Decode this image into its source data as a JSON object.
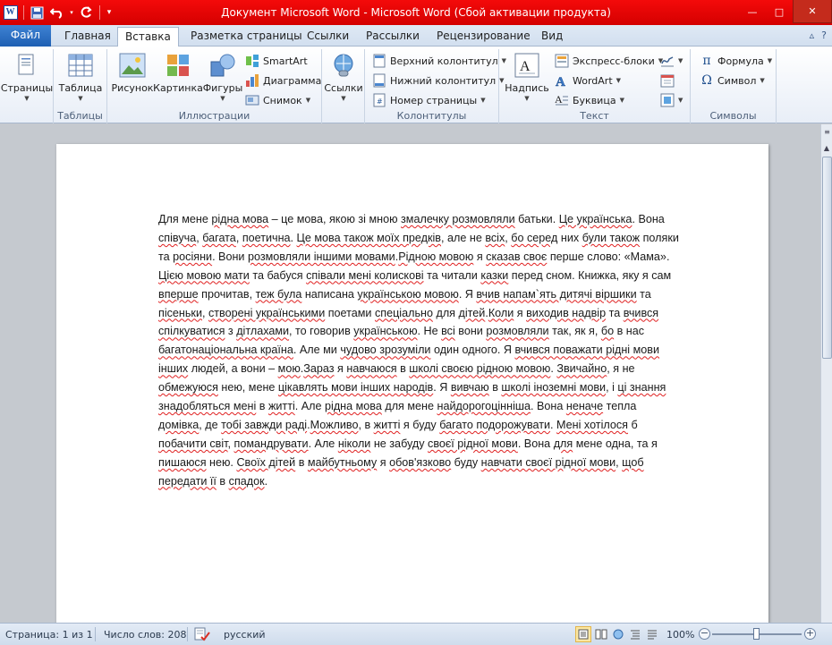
{
  "window": {
    "title": "Документ Microsoft Word  -  Microsoft Word (Сбой активации продукта)",
    "minimize": "—",
    "maximize": "□",
    "close": "✕"
  },
  "qat": {
    "app_icon": "W",
    "save": "save-icon",
    "undo": "undo-icon",
    "redo": "redo-icon",
    "customize": "▾"
  },
  "tabs": {
    "file": "Файл",
    "items": [
      "Главная",
      "Вставка",
      "Разметка страницы",
      "Ссылки",
      "Рассылки",
      "Рецензирование",
      "Вид"
    ],
    "active_index": 1
  },
  "ribbon": {
    "pages": {
      "label": "Страницы",
      "group": ""
    },
    "tables": {
      "table": "Таблица",
      "group": "Таблицы"
    },
    "illustrations": {
      "picture": "Рисунок",
      "clipart": "Картинка",
      "shapes": "Фигуры",
      "smartart": "SmartArt",
      "chart": "Диаграмма",
      "screenshot": "Снимок",
      "group": "Иллюстрации"
    },
    "links": {
      "links": "Ссылки",
      "group": ""
    },
    "headerfooter": {
      "header": "Верхний колонтитул",
      "footer": "Нижний колонтитул",
      "pagenumber": "Номер страницы",
      "group": "Колонтитулы"
    },
    "text": {
      "textbox": "Надпись",
      "quickparts": "Экспресс-блоки",
      "wordart": "WordArt",
      "dropcap": "Буквица",
      "group": "Текст"
    },
    "symbols": {
      "equation": "Формула",
      "symbol": "Символ",
      "group": "Символы"
    }
  },
  "document": {
    "lines": [
      [
        [
          "Для мене ",
          ""
        ],
        [
          "рідна мова",
          "sp"
        ],
        [
          " – ",
          ""
        ],
        [
          "це мова",
          ""
        ],
        [
          ", ",
          ""
        ],
        [
          "якою зі",
          ""
        ],
        [
          " мною ",
          ""
        ],
        [
          "змалечку розмовляли",
          "sp"
        ],
        [
          " батьки. ",
          ""
        ],
        [
          "Це українська",
          "sp"
        ],
        [
          ". Вона",
          ""
        ]
      ],
      [
        [
          "співуча",
          "sp"
        ],
        [
          ", ",
          ""
        ],
        [
          "багата",
          "sp"
        ],
        [
          ", ",
          ""
        ],
        [
          "поетична",
          "sp"
        ],
        [
          ". ",
          ""
        ],
        [
          "Це мова також моїх предків",
          "sp"
        ],
        [
          ", але не ",
          ""
        ],
        [
          "всіх",
          "sp"
        ],
        [
          ", ",
          ""
        ],
        [
          "бо серед",
          "sp"
        ],
        [
          " них ",
          ""
        ],
        [
          "були також",
          "sp"
        ],
        [
          " поляки",
          ""
        ]
      ],
      [
        [
          "та ",
          ""
        ],
        [
          "росіяни",
          "sp"
        ],
        [
          ". Вони ",
          ""
        ],
        [
          "розмовляли іншими мовами",
          "sp"
        ],
        [
          ".",
          ""
        ],
        [
          "Рідною мовою",
          "sp"
        ],
        [
          " я ",
          ""
        ],
        [
          "сказав своє",
          "sp"
        ],
        [
          " перше слово: «Мама».",
          ""
        ]
      ],
      [
        [
          "Цією мовою мати",
          "sp"
        ],
        [
          " та бабуся ",
          ""
        ],
        [
          "співали мені колискові",
          "sp"
        ],
        [
          " та читали ",
          ""
        ],
        [
          "казки",
          "sp"
        ],
        [
          " перед сном. Книжка, яку я сам",
          ""
        ]
      ],
      [
        [
          "вперше",
          "sp"
        ],
        [
          " прочитав, ",
          ""
        ],
        [
          "теж була",
          "sp"
        ],
        [
          " написана ",
          ""
        ],
        [
          "українською мовою",
          "sp"
        ],
        [
          ". Я ",
          ""
        ],
        [
          "вчив напам`ять дитячі віршики",
          "sp"
        ],
        [
          " та",
          ""
        ]
      ],
      [
        [
          "пісеньки",
          "sp"
        ],
        [
          ", ",
          ""
        ],
        [
          "створені українськими",
          "sp"
        ],
        [
          " поетами ",
          ""
        ],
        [
          "спеціально",
          "sp"
        ],
        [
          " для ",
          ""
        ],
        [
          "дітей",
          "sp"
        ],
        [
          ".",
          ""
        ],
        [
          "Коли",
          "sp"
        ],
        [
          " я ",
          ""
        ],
        [
          "виходив надвір",
          "sp"
        ],
        [
          " та ",
          ""
        ],
        [
          "вчився",
          "sp"
        ]
      ],
      [
        [
          "спілкуватися",
          "sp"
        ],
        [
          " з ",
          ""
        ],
        [
          "дітлахами",
          "sp"
        ],
        [
          ", то говорив ",
          ""
        ],
        [
          "українською",
          "sp"
        ],
        [
          ". Не ",
          ""
        ],
        [
          "всі",
          "sp"
        ],
        [
          " вони ",
          ""
        ],
        [
          "розмовляли",
          "sp"
        ],
        [
          " так, як я, ",
          ""
        ],
        [
          "бо",
          "sp"
        ],
        [
          " в нас",
          ""
        ]
      ],
      [
        [
          "багатонаціональна країна",
          "sp"
        ],
        [
          ". Але ми ",
          ""
        ],
        [
          "чудово зрозуміли",
          "sp"
        ],
        [
          " один одного. Я ",
          ""
        ],
        [
          "вчився поважати рідні мови",
          "sp"
        ]
      ],
      [
        [
          "інших",
          "sp"
        ],
        [
          " людей, а вони – ",
          ""
        ],
        [
          "мою",
          "sp"
        ],
        [
          ".",
          ""
        ],
        [
          "Зараз",
          "sp"
        ],
        [
          " я ",
          ""
        ],
        [
          "навчаюся",
          "sp"
        ],
        [
          " в ",
          ""
        ],
        [
          "школі своєю рідною мовою",
          "sp"
        ],
        [
          ". ",
          ""
        ],
        [
          "Звичайно",
          "sp"
        ],
        [
          ", я не",
          ""
        ]
      ],
      [
        [
          "обмежуюся",
          "sp"
        ],
        [
          " нею, мене ",
          ""
        ],
        [
          "цікавлять мови інших народів",
          "sp"
        ],
        [
          ". Я ",
          ""
        ],
        [
          "вивчаю",
          "sp"
        ],
        [
          " в ",
          ""
        ],
        [
          "школі іноземні мови",
          "sp"
        ],
        [
          ", і ",
          ""
        ],
        [
          "ці знання",
          "sp"
        ]
      ],
      [
        [
          "знадобляться мені",
          "sp"
        ],
        [
          " в ",
          ""
        ],
        [
          "житті",
          "sp"
        ],
        [
          ". Але ",
          ""
        ],
        [
          "рідна мова",
          "sp"
        ],
        [
          " для мене ",
          ""
        ],
        [
          "найдорогоцінніша",
          "sp"
        ],
        [
          ". Вона ",
          ""
        ],
        [
          "неначе",
          "sp"
        ],
        [
          " тепла",
          ""
        ]
      ],
      [
        [
          "домівка",
          "sp"
        ],
        [
          ", де ",
          ""
        ],
        [
          "тобі завжди раді",
          "sp"
        ],
        [
          ".",
          ""
        ],
        [
          "Можливо",
          "sp"
        ],
        [
          ", в ",
          ""
        ],
        [
          "житті",
          "sp"
        ],
        [
          " я буду ",
          ""
        ],
        [
          "багато подорожувати",
          "sp"
        ],
        [
          ". ",
          ""
        ],
        [
          "Мені хотілося",
          "sp"
        ],
        [
          " б",
          ""
        ]
      ],
      [
        [
          "побачити світ",
          "sp"
        ],
        [
          ", ",
          ""
        ],
        [
          "помандрувати",
          "sp"
        ],
        [
          ". Але ",
          ""
        ],
        [
          "ніколи",
          "sp"
        ],
        [
          " не забуду ",
          ""
        ],
        [
          "своєї рідної мови",
          "sp"
        ],
        [
          ". Вона ",
          ""
        ],
        [
          "для",
          "sp"
        ],
        [
          " мене одна, та я",
          ""
        ]
      ],
      [
        [
          "пишаюся",
          "sp"
        ],
        [
          " нею. ",
          ""
        ],
        [
          "Своїх дітей",
          "sp"
        ],
        [
          " в ",
          ""
        ],
        [
          "майбутньому",
          "sp"
        ],
        [
          " я ",
          ""
        ],
        [
          "обов'язково",
          "sp"
        ],
        [
          " буду ",
          ""
        ],
        [
          "навчати своєї рідної мови",
          "sp"
        ],
        [
          ", ",
          ""
        ],
        [
          "щоб",
          "sp"
        ]
      ],
      [
        [
          "передати її",
          "sp"
        ],
        [
          " в ",
          ""
        ],
        [
          "спадок",
          "sp"
        ],
        [
          ".",
          ""
        ]
      ]
    ]
  },
  "status": {
    "page": "Страница: 1 из 1",
    "words": "Число слов: 208",
    "language": "русский",
    "zoom": "100%",
    "zoom_minus": "−",
    "zoom_plus": "+"
  }
}
